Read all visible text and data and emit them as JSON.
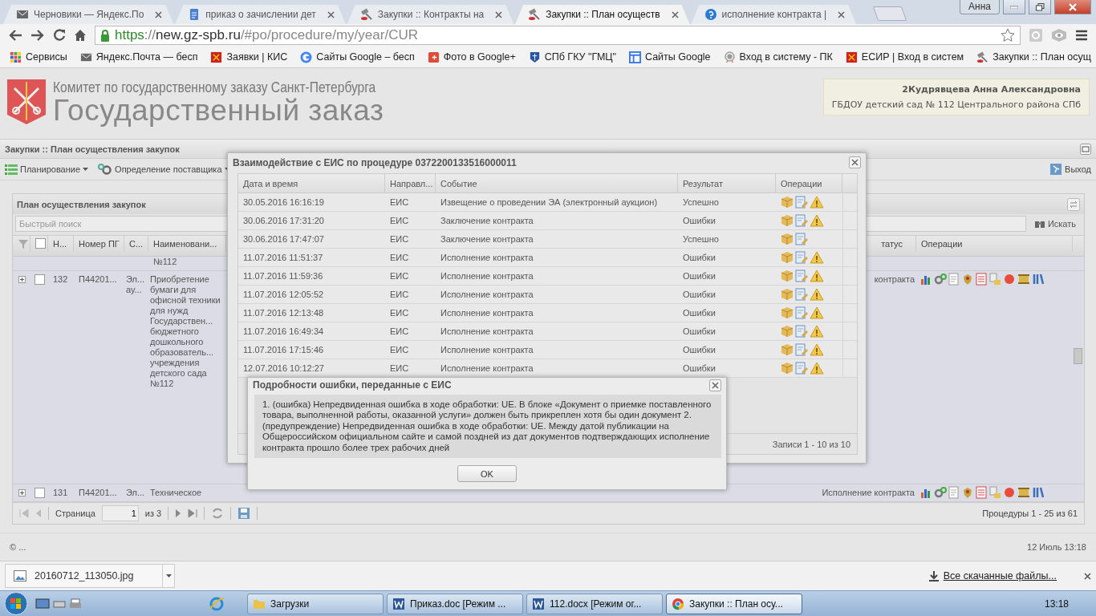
{
  "browser": {
    "tabs": [
      {
        "title": "Черновики — Яндекс.По",
        "kind": "mail",
        "selected": false
      },
      {
        "title": "приказ о зачислении дет",
        "kind": "doc",
        "selected": false
      },
      {
        "title": "Закупки :: Контракты на",
        "kind": "gavel",
        "selected": false
      },
      {
        "title": "Закупки :: План осуществ",
        "kind": "gavel",
        "selected": true
      },
      {
        "title": "исполнение контракта |",
        "kind": "help",
        "selected": false
      }
    ],
    "profile": "Анна",
    "url": {
      "scheme": "https",
      "sep": "://",
      "host": "new.gz-spb.ru",
      "path": "/#po/procedure/my/year/CUR"
    },
    "bookmarks": [
      {
        "label": "Сервисы",
        "kind": "apps"
      },
      {
        "label": "Яндекс.Почта — бесп",
        "kind": "mail"
      },
      {
        "label": "Заявки | КИС",
        "kind": "emblem"
      },
      {
        "label": "Сайты Google – бесп",
        "kind": "google"
      },
      {
        "label": "Фото в Google+",
        "kind": "gplus"
      },
      {
        "label": "СПб ГКУ \"ГМЦ\"",
        "kind": "shield"
      },
      {
        "label": "Сайты Google",
        "kind": "sites"
      },
      {
        "label": "Вход в систему - ПК",
        "kind": "medal"
      },
      {
        "label": "ЕСИР | Вход в систем",
        "kind": "emblem"
      },
      {
        "label": "Закупки :: План осущ",
        "kind": "gavel"
      }
    ]
  },
  "header": {
    "subtitle": "Комитет по государственному заказу Санкт-Петербурга",
    "title": "Государственный заказ",
    "user": {
      "name": "2Кудрявцева Анна Александровна",
      "organization": "ГБДОУ детский сад № 112 Центрального района СПб"
    }
  },
  "main": {
    "title": "Закупки :: План осуществления закупок",
    "toolbar": [
      {
        "label": "Планирование",
        "kind": "planning"
      },
      {
        "label": "Определение поставщика",
        "kind": "supplier"
      }
    ],
    "exit": "Выход",
    "plan": {
      "title": "План осуществления закупок",
      "search_placeholder": "Быстрый поиск",
      "search_button": "Искать",
      "columns": [
        "Н...",
        "Номер ПГ",
        "С...",
        "Наименовани...",
        "татус",
        "Операции"
      ],
      "rows": [
        {
          "kind": "continued",
          "name": "№112"
        },
        {
          "kind": "row",
          "number": "132",
          "pg_number": "П44201...",
          "method": "Эл... ау...",
          "name": "Приобретение бумаги для офисной техники для нужд Государствен... бюджетного дошкольного образователь... учреждения детского сада №112",
          "status": "контракта",
          "checked": false
        },
        {
          "kind": "row",
          "number": "131",
          "pg_number": "П44201...",
          "method": "Эл...",
          "name": "Техническое",
          "status": "Исполнение контракта",
          "checked": false
        }
      ],
      "pager": {
        "page_label": "Страница",
        "page": "1",
        "of": "из 3",
        "summary": "Процедуры 1 - 25 из 61"
      }
    }
  },
  "footer": {
    "copyright": "© ...",
    "datetime": "12 Июль 13:18"
  },
  "eis_dialog": {
    "title": "Взаимодействие с ЕИС по процедуре 0372200133516000011",
    "columns": [
      "Дата и время",
      "Направл...",
      "Событие",
      "Результат",
      "Операции"
    ],
    "rows": [
      {
        "datetime": "30.05.2016 16:16:19",
        "direction": "ЕИС",
        "event": "Извещение о проведении ЭА (электронный аукцион)",
        "result": "Успешно",
        "warning": true
      },
      {
        "datetime": "30.06.2016 17:31:20",
        "direction": "ЕИС",
        "event": "Заключение контракта",
        "result": "Ошибки",
        "warning": true
      },
      {
        "datetime": "30.06.2016 17:47:07",
        "direction": "ЕИС",
        "event": "Заключение контракта",
        "result": "Успешно",
        "warning": false
      },
      {
        "datetime": "11.07.2016 11:51:37",
        "direction": "ЕИС",
        "event": "Исполнение контракта",
        "result": "Ошибки",
        "warning": true
      },
      {
        "datetime": "11.07.2016 11:59:36",
        "direction": "ЕИС",
        "event": "Исполнение контракта",
        "result": "Ошибки",
        "warning": true
      },
      {
        "datetime": "11.07.2016 12:05:52",
        "direction": "ЕИС",
        "event": "Исполнение контракта",
        "result": "Ошибки",
        "warning": true
      },
      {
        "datetime": "11.07.2016 12:13:48",
        "direction": "ЕИС",
        "event": "Исполнение контракта",
        "result": "Ошибки",
        "warning": true
      },
      {
        "datetime": "11.07.2016 16:49:34",
        "direction": "ЕИС",
        "event": "Исполнение контракта",
        "result": "Ошибки",
        "warning": true
      },
      {
        "datetime": "11.07.2016 17:15:46",
        "direction": "ЕИС",
        "event": "Исполнение контракта",
        "result": "Ошибки",
        "warning": true
      },
      {
        "datetime": "12.07.2016 10:12:27",
        "direction": "ЕИС",
        "event": "Исполнение контракта",
        "result": "Ошибки",
        "warning": true
      }
    ],
    "records": "Записи 1 - 10 из 10"
  },
  "error_dialog": {
    "title": "Подробности ошибки, переданные с ЕИС",
    "message": "1. (ошибка) Непредвиденная ошибка в ходе обработки: UE. В блоке «Документ о приемке поставленного товара, выполненной работы, оказанной услуги» должен быть прикреплен хотя бы один документ 2. (предупреждение) Непредвиденная ошибка в ходе обработки: UE. Между датой публикации на Общероссийском официальном сайте и самой поздней из дат документов подтверждающих исполнение контракта прошло более трех рабочих дней",
    "ok": "OK"
  },
  "downloads": {
    "file": "20160712_113050.jpg",
    "all": "Все скачанные файлы..."
  },
  "taskbar": {
    "items": [
      {
        "label": "Загрузки",
        "kind": "folder",
        "selected": false
      },
      {
        "label": "Приказ.doc [Режим ...",
        "kind": "word",
        "selected": false
      },
      {
        "label": "112.docx [Режим ог...",
        "kind": "word",
        "selected": false
      },
      {
        "label": "Закупки :: План осу...",
        "kind": "chrome",
        "selected": true
      }
    ],
    "time": "13:18"
  }
}
